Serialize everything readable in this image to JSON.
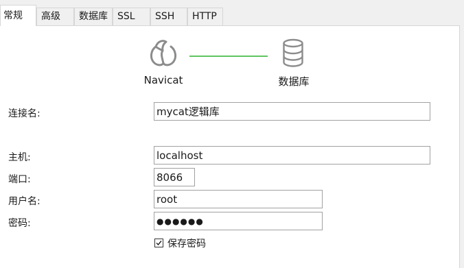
{
  "tabs": [
    {
      "label": "常规",
      "active": true
    },
    {
      "label": "高级",
      "active": false
    },
    {
      "label": "数据库",
      "active": false
    },
    {
      "label": "SSL",
      "active": false
    },
    {
      "label": "SSH",
      "active": false
    },
    {
      "label": "HTTP",
      "active": false
    }
  ],
  "header": {
    "left_label": "Navicat",
    "left_icon": "navicat-logo-icon",
    "right_label": "数据库",
    "right_icon": "database-icon",
    "connector_color": "#5ec45e"
  },
  "form": {
    "connection_name_label": "连接名:",
    "connection_name_value": "mycat逻辑库",
    "host_label": "主机:",
    "host_value": "localhost",
    "port_label": "端口:",
    "port_value": "8066",
    "username_label": "用户名:",
    "username_value": "root",
    "password_label": "密码:",
    "password_mask": "●●●●●●",
    "save_password_label": "保存密码",
    "save_password_checked": true
  }
}
